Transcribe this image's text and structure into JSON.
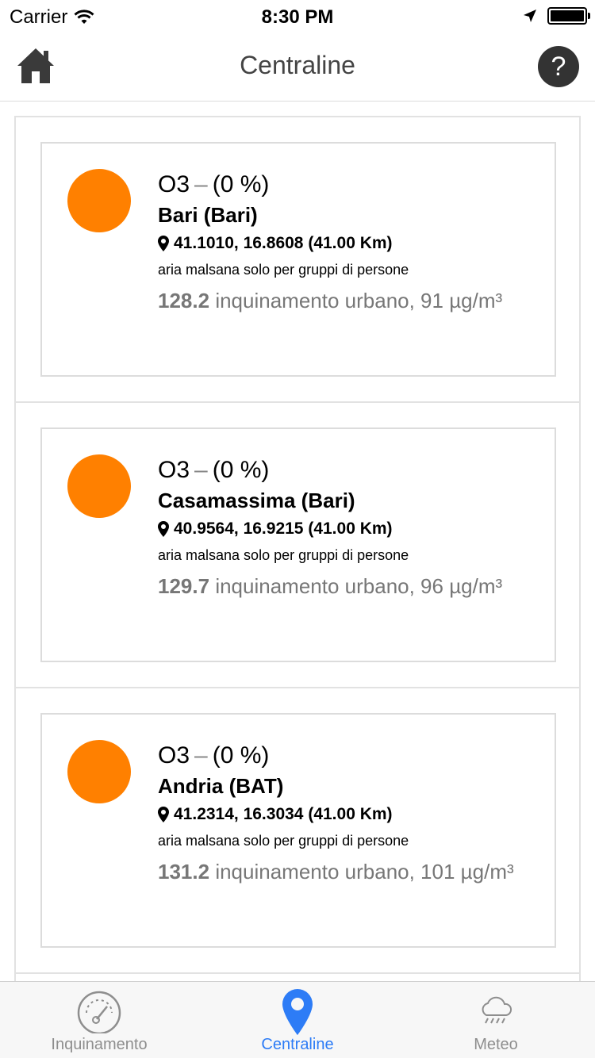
{
  "status_bar": {
    "carrier": "Carrier",
    "time": "8:30 PM"
  },
  "nav": {
    "title": "Centraline",
    "help_label": "?"
  },
  "stations": [
    {
      "pollutant": "O3",
      "separator": "–",
      "percent": "(0 %)",
      "name": "Bari (Bari)",
      "coords": "41.1010, 16.8608 (41.00 Km)",
      "quality": "aria malsana solo per gruppi di persone",
      "value": "128.2",
      "description": "inquinamento urbano, 91 µg/m³",
      "dot_color": "#ff8000"
    },
    {
      "pollutant": "O3",
      "separator": "–",
      "percent": "(0 %)",
      "name": "Casamassima (Bari)",
      "coords": "40.9564, 16.9215 (41.00 Km)",
      "quality": "aria malsana solo per gruppi di persone",
      "value": "129.7",
      "description": "inquinamento urbano, 96 µg/m³",
      "dot_color": "#ff8000"
    },
    {
      "pollutant": "O3",
      "separator": "–",
      "percent": "(0 %)",
      "name": "Andria (BAT)",
      "coords": "41.2314, 16.3034 (41.00 Km)",
      "quality": "aria malsana solo per gruppi di persone",
      "value": "131.2",
      "description": "inquinamento urbano, 101 µg/m³",
      "dot_color": "#ff8000"
    }
  ],
  "tabs": [
    {
      "label": "Inquinamento",
      "icon": "gauge-icon",
      "active": false
    },
    {
      "label": "Centraline",
      "icon": "location-pin-icon",
      "active": true
    },
    {
      "label": "Meteo",
      "icon": "rain-cloud-icon",
      "active": false
    }
  ],
  "colors": {
    "accent": "#2d7cf6",
    "status_orange": "#ff8000",
    "inactive_tab": "#8e8e8e"
  }
}
